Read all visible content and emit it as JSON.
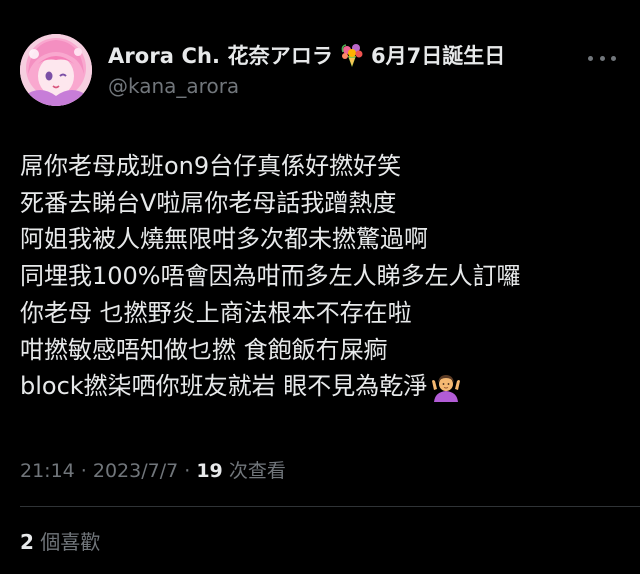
{
  "colors": {
    "background": "#000000",
    "text_primary": "#e7e9ea",
    "text_secondary": "#71767b",
    "divider": "#2f3336"
  },
  "author": {
    "display_name": "Arora Ch. 花奈アロラ",
    "name_emoji": "bouquet-icon",
    "birthday_text": "6月7日誕生日",
    "handle": "@kana_arora"
  },
  "tweet": {
    "lines": [
      "屌你老母成班on9台仔真係好撚好笑",
      "死番去睇台V啦屌你老母話我蹭熱度",
      "阿姐我被人燒無限咁多次都未撚驚過啊",
      "同埋我100%唔會因為咁而多左人睇多左人訂囉",
      "你老母 乜撚野炎上商法根本不存在啦",
      "咁撚敏感唔知做乜撚 食飽飯冇屎痾",
      "block撚柒哂你班友就岩 眼不見為乾淨"
    ],
    "end_emoji": "shrug-icon"
  },
  "meta": {
    "timestamp": "21:14 · 2023/7/7 · ",
    "views_count": "19",
    "views_label": " 次查看"
  },
  "engagement": {
    "likes_count": "2",
    "likes_label": " 個喜歡"
  }
}
